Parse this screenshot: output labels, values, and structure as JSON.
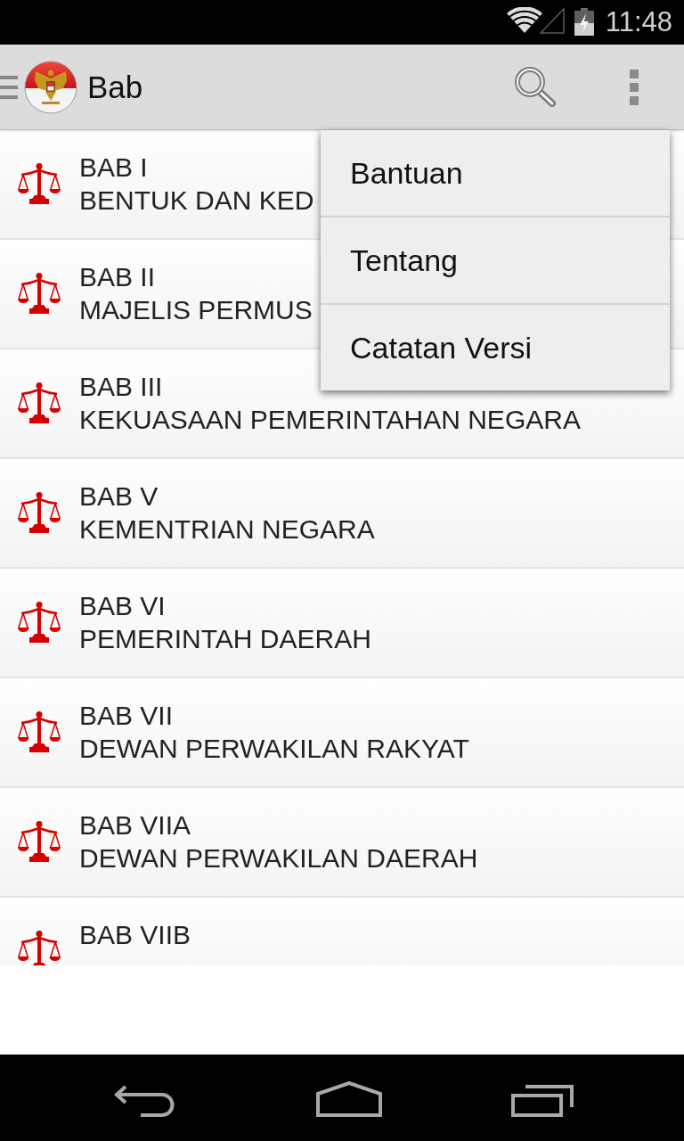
{
  "status_bar": {
    "time": "11:48"
  },
  "app_bar": {
    "title": "Bab"
  },
  "chapters": [
    {
      "title": "BAB I",
      "subtitle": "BENTUK DAN KED"
    },
    {
      "title": "BAB II",
      "subtitle": "MAJELIS PERMUS"
    },
    {
      "title": "BAB III",
      "subtitle": "KEKUASAAN PEMERINTAHAN NEGARA"
    },
    {
      "title": "BAB V",
      "subtitle": "KEMENTRIAN NEGARA"
    },
    {
      "title": "BAB VI",
      "subtitle": "PEMERINTAH DAERAH"
    },
    {
      "title": "BAB VII",
      "subtitle": "DEWAN PERWAKILAN RAKYAT"
    },
    {
      "title": "BAB VIIA",
      "subtitle": "DEWAN PERWAKILAN DAERAH"
    },
    {
      "title": "BAB VIIB"
    }
  ],
  "overflow_menu": {
    "items": [
      "Bantuan",
      "Tentang",
      "Catatan Versi"
    ]
  }
}
